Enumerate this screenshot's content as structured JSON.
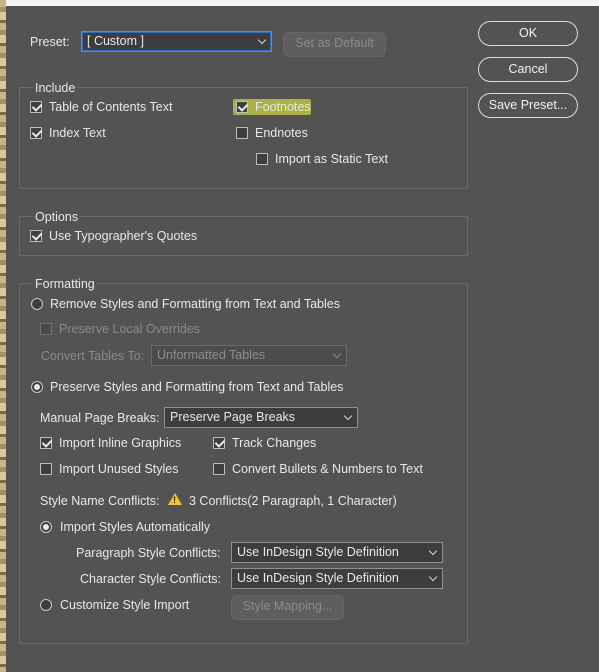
{
  "preset": {
    "label": "Preset:",
    "value": "[ Custom ]",
    "set_default_label": "Set as Default"
  },
  "buttons": {
    "ok": "OK",
    "cancel": "Cancel",
    "save_preset": "Save Preset..."
  },
  "include": {
    "title": "Include",
    "toc": {
      "label": "Table of Contents Text",
      "checked": true
    },
    "footnotes": {
      "label": "Footnotes",
      "checked": true
    },
    "index": {
      "label": "Index Text",
      "checked": true
    },
    "endnotes": {
      "label": "Endnotes",
      "checked": false
    },
    "static_text": {
      "label": "Import as Static Text",
      "checked": false
    }
  },
  "options": {
    "title": "Options",
    "typographers_quotes": {
      "label": "Use Typographer's Quotes",
      "checked": true
    }
  },
  "formatting": {
    "title": "Formatting",
    "remove_styles": {
      "label": "Remove Styles and Formatting from Text and Tables",
      "selected": false
    },
    "preserve_overrides": {
      "label": "Preserve Local Overrides",
      "checked": false,
      "disabled": true
    },
    "convert_tables_label": "Convert Tables To:",
    "convert_tables_value": "Unformatted Tables",
    "preserve_styles": {
      "label": "Preserve Styles and Formatting from Text and Tables",
      "selected": true
    },
    "manual_breaks_label": "Manual Page Breaks:",
    "manual_breaks_value": "Preserve Page Breaks",
    "inline_graphics": {
      "label": "Import Inline Graphics",
      "checked": true
    },
    "track_changes": {
      "label": "Track Changes",
      "checked": true
    },
    "unused_styles": {
      "label": "Import Unused Styles",
      "checked": false
    },
    "convert_bullets": {
      "label": "Convert Bullets & Numbers to Text",
      "checked": false
    },
    "conflicts_label": "Style Name Conflicts:",
    "conflicts_value": "3 Conflicts(2 Paragraph, 1 Character)",
    "import_auto": {
      "label": "Import Styles Automatically",
      "selected": true
    },
    "para_conflicts_label": "Paragraph Style Conflicts:",
    "para_conflicts_value": "Use InDesign Style Definition",
    "char_conflicts_label": "Character Style Conflicts:",
    "char_conflicts_value": "Use InDesign Style Definition",
    "customize": {
      "label": "Customize Style Import",
      "selected": false
    },
    "style_mapping_label": "Style Mapping..."
  },
  "colors": {
    "background": "#535353",
    "focus_border": "#4f8fe0",
    "highlight": "#f4ff3b",
    "warning": "#f2c230"
  },
  "icons": [
    "checkbox",
    "radio-button",
    "chevron-down-icon",
    "warning-icon"
  ]
}
